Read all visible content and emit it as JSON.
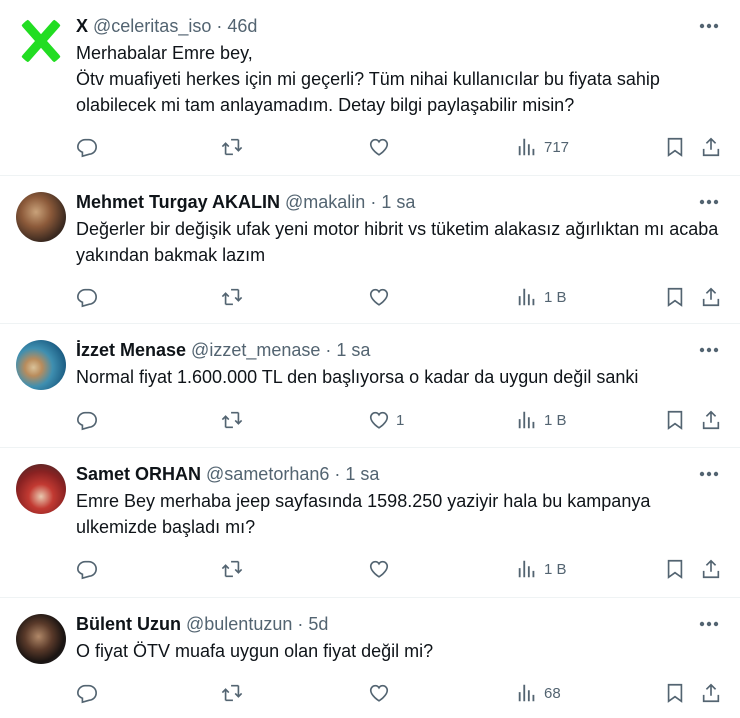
{
  "tweets": [
    {
      "name": "X",
      "handle": "@celeritas_iso",
      "time": "46d",
      "lines": [
        "Merhabalar Emre bey,",
        "Ötv muafiyeti herkes için mi geçerli? Tüm nihai kullanıcılar bu fiyata sahip olabilecek mi tam anlayamadım. Detay bilgi paylaşabilir misin?"
      ],
      "likes": "",
      "views": "717"
    },
    {
      "name": "Mehmet Turgay AKALIN",
      "handle": "@makalin",
      "time": "1 sa",
      "lines": [
        "Değerler bir değişik ufak yeni motor hibrit vs tüketim alakasız ağırlıktan mı acaba yakından bakmak lazım"
      ],
      "likes": "",
      "views": "1 B"
    },
    {
      "name": "İzzet Menase",
      "handle": "@izzet_menase",
      "time": "1 sa",
      "lines": [
        "Normal fiyat 1.600.000 TL den başlıyorsa o kadar da uygun değil sanki"
      ],
      "likes": "1",
      "views": "1 B"
    },
    {
      "name": "Samet ORHAN",
      "handle": "@sametorhan6",
      "time": "1 sa",
      "lines": [
        "Emre Bey merhaba jeep sayfasında 1598.250 yaziyir hala bu kampanya ulkemizde başladı mı?"
      ],
      "likes": "",
      "views": "1 B"
    },
    {
      "name": "Bülent Uzun",
      "handle": "@bulentuzun",
      "time": "5d",
      "lines": [
        "O fiyat ÖTV muafa uygun olan fiyat değil mi?"
      ],
      "likes": "",
      "views": "68"
    }
  ],
  "separator": "·",
  "colors": {
    "text": "#0f1419",
    "muted": "#536471",
    "border": "#eff3f4",
    "x_logo": "#22dd22"
  },
  "icons": {
    "reply": "reply-icon",
    "retweet": "retweet-icon",
    "like": "heart-icon",
    "views": "views-icon",
    "bookmark": "bookmark-icon",
    "share": "share-icon",
    "more": "more-icon"
  }
}
